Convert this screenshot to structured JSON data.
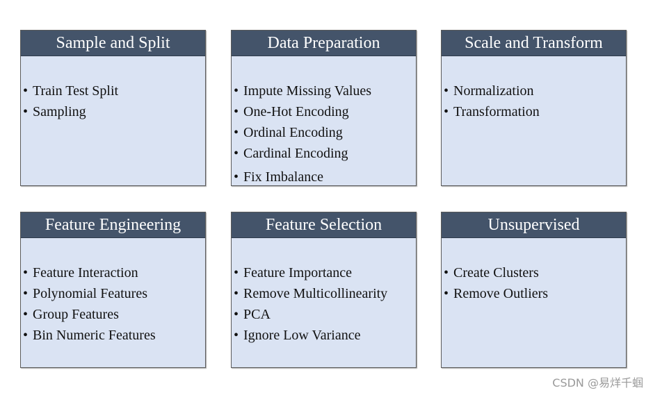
{
  "boxes": [
    {
      "title": "Sample and Split",
      "items": [
        "Train Test Split",
        "Sampling"
      ]
    },
    {
      "title": "Data Preparation",
      "items": [
        "Impute Missing Values",
        "One-Hot Encoding",
        "Ordinal Encoding",
        "Cardinal Encoding",
        "Fix Imbalance"
      ]
    },
    {
      "title": "Scale and Transform",
      "items": [
        "Normalization",
        "Transformation"
      ]
    },
    {
      "title": "Feature Engineering",
      "items": [
        "Feature Interaction",
        "Polynomial Features",
        "Group Features",
        "Bin Numeric Features"
      ]
    },
    {
      "title": "Feature Selection",
      "items": [
        "Feature Importance",
        "Remove Multicollinearity",
        "PCA",
        "Ignore Low Variance"
      ]
    },
    {
      "title": "Unsupervised",
      "items": [
        "Create Clusters",
        "Remove Outliers"
      ]
    }
  ],
  "watermark": "CSDN @易烊千蝈",
  "colors": {
    "header": "#44546a",
    "body": "#dae3f3"
  }
}
